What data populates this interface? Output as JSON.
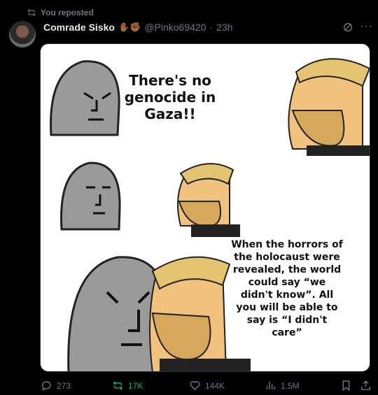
{
  "repost": {
    "label": "You reposted"
  },
  "author": {
    "name": "Comrade Sisko",
    "emoji": "✋🏾✊🏾",
    "handle": "@Pinko69420",
    "separator": "·",
    "time": "23h"
  },
  "meme": {
    "caption_top": "There's no genocide in Gaza!!",
    "caption_bottom": "When the horrors of the holocaust were revealed, the world could say “we didn't know”. All you will be able to say is “I didn't care”"
  },
  "actions": {
    "replies": "273",
    "reposts": "17K",
    "likes": "144K",
    "views": "1.5M"
  },
  "colors": {
    "background": "#000000",
    "muted": "#71767b",
    "repost_active": "#00ba7c"
  }
}
